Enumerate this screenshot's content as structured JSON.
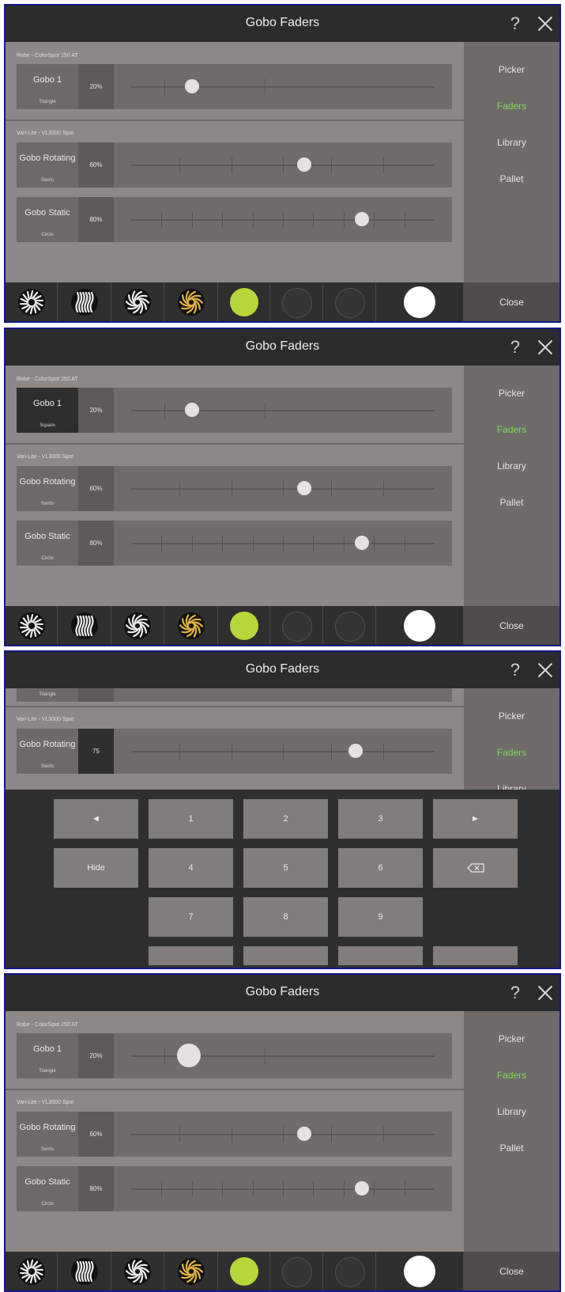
{
  "dialog": {
    "title": "Gobo Faders",
    "help": "?",
    "close_label": "Close"
  },
  "sidebar": [
    "Picker",
    "Faders",
    "Library",
    "Pallet"
  ],
  "active_tab": "Faders",
  "fixtures": {
    "robe": "Robe - ColorSpot 250 AT",
    "varilite": "Vari-Lite - VL3000 Spot"
  },
  "faders": {
    "gobo1": {
      "name": "Gobo 1",
      "value_text": "20%",
      "position": 0.2
    },
    "rotating": {
      "name": "Gobo Rotating",
      "sub": "Swirls",
      "value_text": "60%",
      "position": 0.57
    },
    "static": {
      "name": "Gobo Static",
      "sub": "Circle",
      "value_text": "80%",
      "position": 0.76
    }
  },
  "screen1": {
    "gobo1_sub": "Triangle"
  },
  "screen2": {
    "gobo1_sub": "Square"
  },
  "screen3": {
    "top_partial_sub": "Triangle",
    "rotating_value": "75",
    "rotating_position": 0.74,
    "partial_tab": "Library",
    "keys": {
      "left": "◄",
      "right": "►",
      "hide": "Hide",
      "backspace": "⌫",
      "digits": [
        "1",
        "2",
        "3",
        "4",
        "5",
        "6",
        "7",
        "8",
        "9"
      ]
    }
  },
  "screen4": {
    "gobo1_sub": "Triangle",
    "gobo1_position": 0.19
  },
  "swatches": [
    {
      "kind": "gobo",
      "icon": "gobo-burst-icon",
      "color": "#f0f0f0"
    },
    {
      "kind": "gobo",
      "icon": "gobo-wave-icon",
      "color": "#f0f0f0"
    },
    {
      "kind": "gobo",
      "icon": "gobo-swirl-icon",
      "color": "#f0f0f0"
    },
    {
      "kind": "gobo",
      "icon": "gobo-swirl-yellow-icon",
      "color": "#e6b43c"
    },
    {
      "kind": "color",
      "icon": "swatch-green",
      "color": "#b7d63a"
    },
    {
      "kind": "color",
      "icon": "swatch-dark",
      "color": "#343434"
    },
    {
      "kind": "color",
      "icon": "swatch-dark",
      "color": "#343434"
    },
    {
      "kind": "color",
      "icon": "swatch-white",
      "color": "#ffffff"
    }
  ]
}
